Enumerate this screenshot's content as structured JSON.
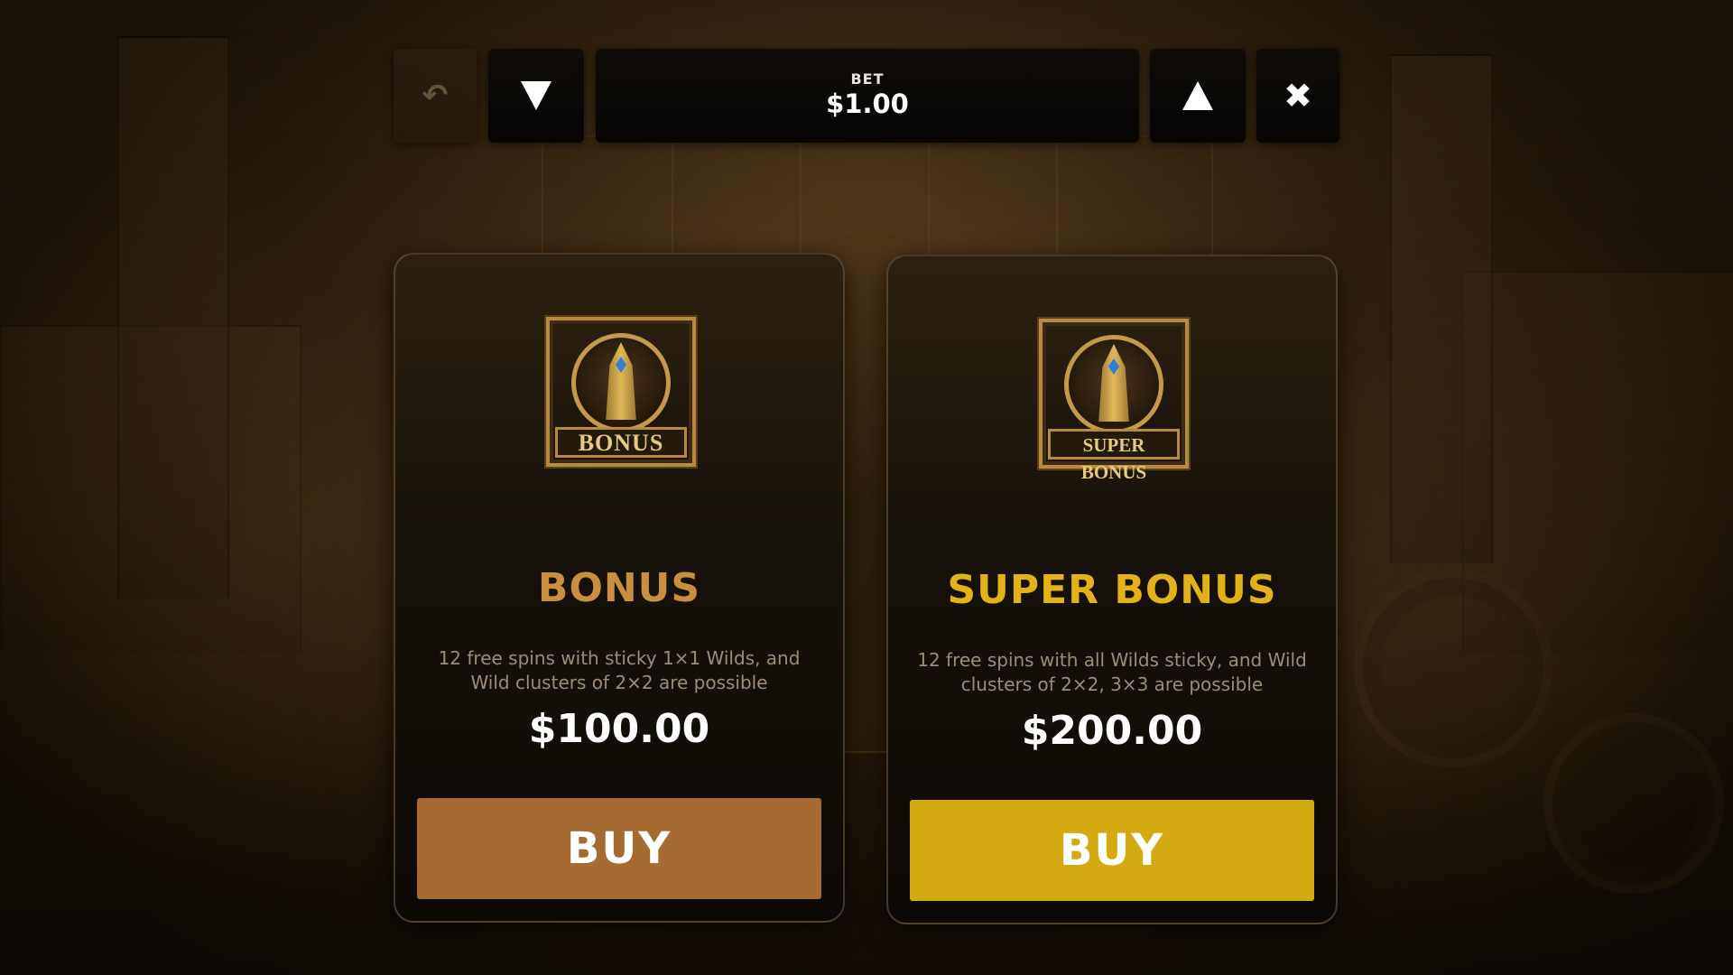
{
  "bet_bar": {
    "bet_label": "BET",
    "bet_value": "$1.00",
    "undo_glyph": "↶",
    "close_glyph": "✖"
  },
  "offers": [
    {
      "icon_label": "BONUS",
      "title": "BONUS",
      "description": "12 free spins with sticky 1×1 Wilds, and Wild clusters of 2×2 are possible",
      "price": "$100.00",
      "buy_label": "BUY",
      "title_color": "#c8903e",
      "button_color": "#a56b30"
    },
    {
      "icon_label": "SUPER BONUS",
      "title": "SUPER BONUS",
      "description": "12 free spins with all Wilds sticky, and Wild clusters of 2×2, 3×3 are possible",
      "price": "$200.00",
      "buy_label": "BUY",
      "title_color": "#e2b21a",
      "button_color": "#d3aa10"
    }
  ],
  "icons": {
    "undo": "undo-icon",
    "decrease": "triangle-down-icon",
    "increase": "triangle-up-icon",
    "close": "close-icon",
    "bonus_symbol": "bonus-temple-icon"
  }
}
